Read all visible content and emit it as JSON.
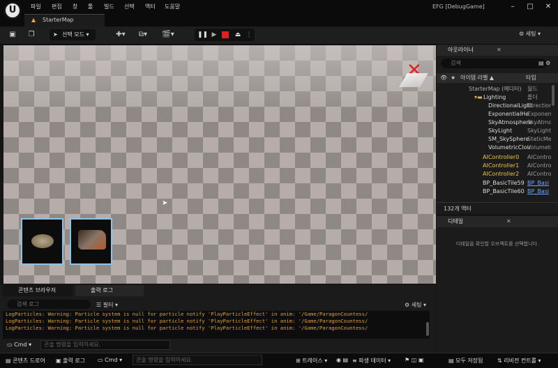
{
  "app": {
    "title": "EFG [DebugGame]",
    "logo": "U"
  },
  "menu": [
    "파일",
    "편집",
    "창",
    "툴",
    "빌드",
    "선택",
    "액터",
    "도움말"
  ],
  "tab": {
    "label": "StarterMap"
  },
  "toolbar": {
    "mode_label": "선택 모드",
    "settings_label": "세팅"
  },
  "outliner": {
    "tab_label": "아웃라이너",
    "search_placeholder": "검색",
    "col_label": "아이템 라벨 ▲",
    "col_type": "타입",
    "rows": [
      {
        "name": "StarterMap (에디터)",
        "type": "월드"
      },
      {
        "name": "Lighting",
        "type": "폴더"
      },
      {
        "name": "DirectionalLight",
        "type": "Direction"
      },
      {
        "name": "ExponentialHe",
        "type": "Exponent"
      },
      {
        "name": "SkyAtmosphere",
        "type": "SkyAtmo"
      },
      {
        "name": "SkyLight",
        "type": "SkyLight"
      },
      {
        "name": "SM_SkySphere",
        "type": "StaticMe"
      },
      {
        "name": "VolumetricClou",
        "type": "Volumetri"
      },
      {
        "name": "AIController0",
        "type": "AIControl"
      },
      {
        "name": "AIController1",
        "type": "AIControl"
      },
      {
        "name": "AIController2",
        "type": "AIControl"
      },
      {
        "name": "BP_BasicTile59",
        "type": "BP_Basi"
      },
      {
        "name": "BP_BasicTile60",
        "type": "BP_Basi"
      }
    ],
    "count": "132개 액터"
  },
  "details": {
    "tab_label": "디테일",
    "message": "디테일을 확인할 오브젝트를 선택합니다."
  },
  "bottom": {
    "tab_content": "콘텐츠 브라우저",
    "tab_log": "출력 로그",
    "search_placeholder": "검색 로그",
    "filter_label": "필터",
    "settings_label": "세팅",
    "log_lines": [
      "LogParticles: Warning: Particle system is null for particle notify 'PlayParticleEffect' in anim: '/Game/ParagonCountess/",
      "LogParticles: Warning: Particle system is null for particle notify 'PlayParticleEffect' in anim: '/Game/ParagonCountess/",
      "LogParticles: Warning: Particle system is null for particle notify 'PlayParticleEffect' in anim: '/Game/ParagonCountess/"
    ],
    "cmd_label": "Cmd",
    "cmd_placeholder": "콘솔 명령을 입력하세요."
  },
  "status": {
    "content_drawer": "콘텐츠 드로어",
    "output_log": "출력 로그",
    "cmd_label": "Cmd",
    "cmd_placeholder": "콘솔 명령을 입력하세요.",
    "trace": "트레이스",
    "derived_data": "파생 데이터",
    "save_all": "모두 저장됨",
    "revision": "리비전 컨트롤"
  }
}
